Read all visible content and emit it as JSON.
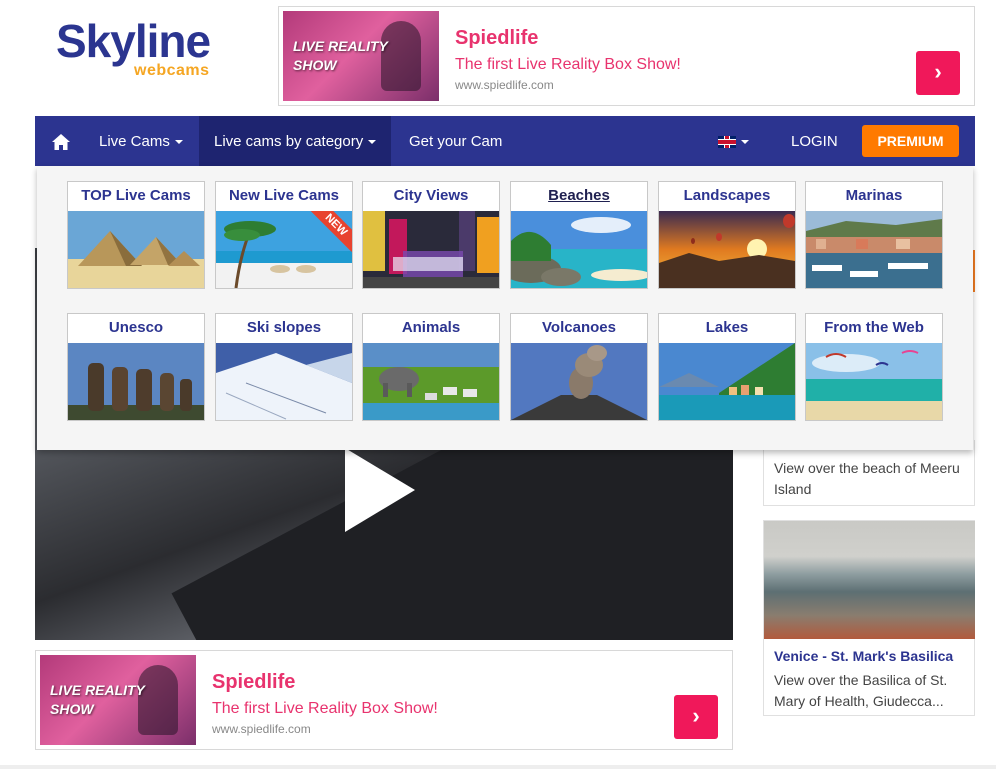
{
  "logo": {
    "main": "Skyline",
    "sub": "webcams"
  },
  "top_ad": {
    "thumb_text": "LIVE REALITY\nSHOW",
    "title": "Spiedlife",
    "description": "The first Live Reality Box Show!",
    "url": "www.spiedlife.com",
    "button": "›"
  },
  "nav": {
    "home_icon": "home-icon",
    "items": [
      {
        "label": "Live Cams"
      },
      {
        "label": "Live cams by category"
      },
      {
        "label": "Get your Cam"
      }
    ],
    "login": "LOGIN",
    "premium": "PREMIUM"
  },
  "categories": [
    {
      "label": "TOP Live Cams"
    },
    {
      "label": "New Live Cams",
      "badge": "NEW"
    },
    {
      "label": "City Views"
    },
    {
      "label": "Beaches"
    },
    {
      "label": "Landscapes"
    },
    {
      "label": "Marinas"
    },
    {
      "label": "Unesco"
    },
    {
      "label": "Ski slopes"
    },
    {
      "label": "Animals"
    },
    {
      "label": "Volcanoes"
    },
    {
      "label": "Lakes"
    },
    {
      "label": "From the Web"
    }
  ],
  "sidebar": {
    "card1_text": "View over the beach of Meeru Island",
    "card2_title": "Venice - St. Mark's Basilica",
    "card2_text": "View over the Basilica of St. Mary of Health, Giudecca..."
  },
  "bottom_ad": {
    "thumb_text": "LIVE REALITY\nSHOW",
    "title": "Spiedlife",
    "description": "The first Live Reality Box Show!",
    "url": "www.spiedlife.com",
    "button": "›"
  },
  "colors": {
    "nav": "#2c3490",
    "premium": "#ff7a00",
    "ad_accent": "#e8336e",
    "ad_button": "#f0185a"
  }
}
